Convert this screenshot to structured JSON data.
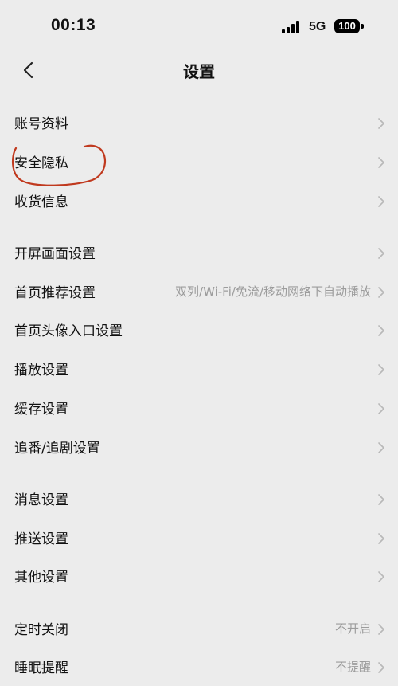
{
  "status": {
    "time": "00:13",
    "network": "5G",
    "battery": "100"
  },
  "nav": {
    "title": "设置"
  },
  "rows": [
    {
      "label": "账号资料",
      "value": ""
    },
    {
      "label": "安全隐私",
      "value": ""
    },
    {
      "label": "收货信息",
      "value": ""
    },
    {
      "label": "开屏画面设置",
      "value": ""
    },
    {
      "label": "首页推荐设置",
      "value": "双列/Wi-Fi/免流/移动网络下自动播放"
    },
    {
      "label": "首页头像入口设置",
      "value": ""
    },
    {
      "label": "播放设置",
      "value": ""
    },
    {
      "label": "缓存设置",
      "value": ""
    },
    {
      "label": "追番/追剧设置",
      "value": ""
    },
    {
      "label": "消息设置",
      "value": ""
    },
    {
      "label": "推送设置",
      "value": ""
    },
    {
      "label": "其他设置",
      "value": ""
    },
    {
      "label": "定时关闭",
      "value": "不开启"
    },
    {
      "label": "睡眠提醒",
      "value": "不提醒"
    }
  ],
  "colors": {
    "background": "#ececec",
    "annotation": "#c0391e",
    "secondary_text": "#9c9c9c"
  }
}
